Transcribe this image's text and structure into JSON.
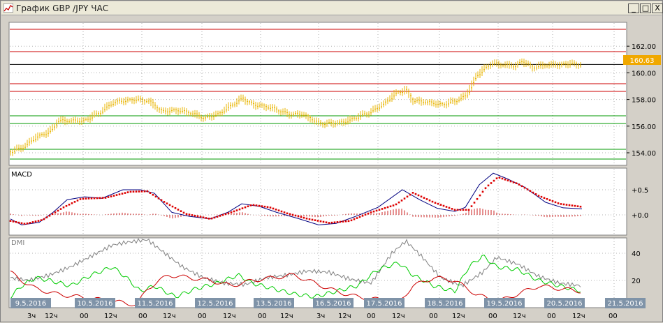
{
  "window": {
    "title": "График GBP /JPY ЧАС",
    "minimize_glyph": "_",
    "maximize_glyph": "□",
    "close_glyph": "X"
  },
  "price_pane": {
    "y_ticks": [
      "162.00",
      "160.00",
      "158.00",
      "156.00",
      "154.00"
    ],
    "last_price": "160.63",
    "candle_color": "#e8b400",
    "resistance_color": "#cc0000",
    "support_color": "#009900"
  },
  "macd_pane": {
    "label": "MACD",
    "y_ticks": [
      "+0.5",
      "+0.0"
    ],
    "macd_color": "#000080",
    "signal_color": "#dd0000"
  },
  "dmi_pane": {
    "label": "DMI",
    "y_ticks": [
      "40",
      "20"
    ],
    "adx_color": "#808080",
    "plus_di_color": "#00cc00",
    "minus_di_color": "#cc0000"
  },
  "time_axis": {
    "date_labels": [
      "9.5.2016",
      "10.5.2016",
      "11.5.2016",
      "12.5.2016",
      "13.5.2016",
      "16.5.2016",
      "17.5.2016",
      "18.5.2016",
      "19.5.2016",
      "20.5.2016",
      "21.5.2016"
    ],
    "hour_labels": [
      "3ч",
      "12ч",
      "00",
      "12ч",
      "00",
      "12ч",
      "00",
      "12ч",
      "00",
      "12ч",
      "3ч",
      "12ч",
      "00",
      "12ч",
      "00",
      "12ч",
      "00",
      "12ч",
      "00",
      "12ч",
      "00"
    ]
  }
}
